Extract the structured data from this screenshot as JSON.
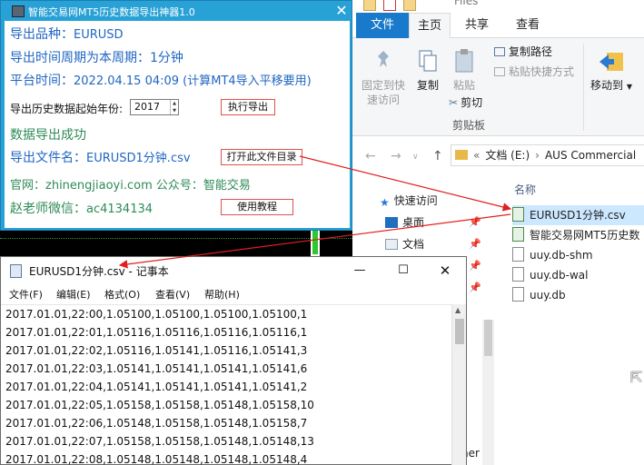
{
  "explorer": {
    "title_fragment": "Files",
    "tabs": [
      "文件",
      "主页",
      "共享",
      "查看"
    ],
    "ribbon": {
      "pin": "固定到快速访问",
      "copy": "复制",
      "paste": "粘贴",
      "copy_path": "复制路径",
      "paste_shortcut": "粘贴快捷方式",
      "cut": "剪切",
      "group": "剪贴板",
      "move_to": "移动到"
    },
    "address": [
      "文档 (E:)",
      "AUS Commercial"
    ],
    "nav": {
      "quick_access": "快速访问",
      "desktop": "桌面",
      "documents": "文档"
    },
    "column_header": "名称",
    "files": [
      "EURUSD1分钟.csv",
      "智能交易网MT5历史数",
      "uuy.db-shm",
      "uuy.db-wal",
      "uuy.db"
    ],
    "selected_file_index": 0,
    "stub_text": "her"
  },
  "tool": {
    "title": "智能交易网MT5历史数据导出神器1.0",
    "variety_label": "导出品种：",
    "variety_value": "EURUSD",
    "period_text": "导出时间周期为本周期：1分钟",
    "platform_label": "平台时间：",
    "platform_value": "2022.04.15 04:09 (计算MT4导入平移要用)",
    "start_year_label": "导出历史数据起始年份:",
    "start_year_value": "2017",
    "export_button": "执行导出",
    "success_text": "数据导出成功",
    "file_label": "导出文件名：",
    "file_value": "EURUSD1分钟.csv",
    "open_dir_button": "打开此文件目录",
    "website_text": "官网：zhinengjiaoyi.com 公众号：智能交易",
    "wechat_label": "赵老师微信：",
    "wechat_value": "ac4134134",
    "tutorial_button": "使用教程"
  },
  "notepad": {
    "title": "EURUSD1分钟.csv - 记事本",
    "menu": [
      "文件(F)",
      "编辑(E)",
      "格式(O)",
      "查看(V)",
      "帮助(H)"
    ],
    "lines": [
      "2017.01.01,22:00,1.05100,1.05100,1.05100,1.05100,1",
      "2017.01.01,22:01,1.05116,1.05116,1.05116,1.05116,1",
      "2017.01.01,22:02,1.05116,1.05141,1.05116,1.05141,3",
      "2017.01.01,22:03,1.05141,1.05141,1.05141,1.05141,6",
      "2017.01.01,22:04,1.05141,1.05141,1.05141,1.05141,2",
      "2017.01.01,22:05,1.05158,1.05158,1.05148,1.05158,10",
      "2017.01.01,22:06,1.05148,1.05158,1.05148,1.05158,7",
      "2017.01.01,22:07,1.05158,1.05158,1.05148,1.05148,13",
      "2017.01.01,22:08,1.05148,1.05148,1.05148,1.05148,4"
    ]
  },
  "colors": {
    "tool_frame": "#27a1d6",
    "tool_blue_text": "#2066c2",
    "tool_green_text": "#2e8b57",
    "button_border": "#e05050",
    "selection": "#cce8ff",
    "arrow": "#e02020"
  }
}
